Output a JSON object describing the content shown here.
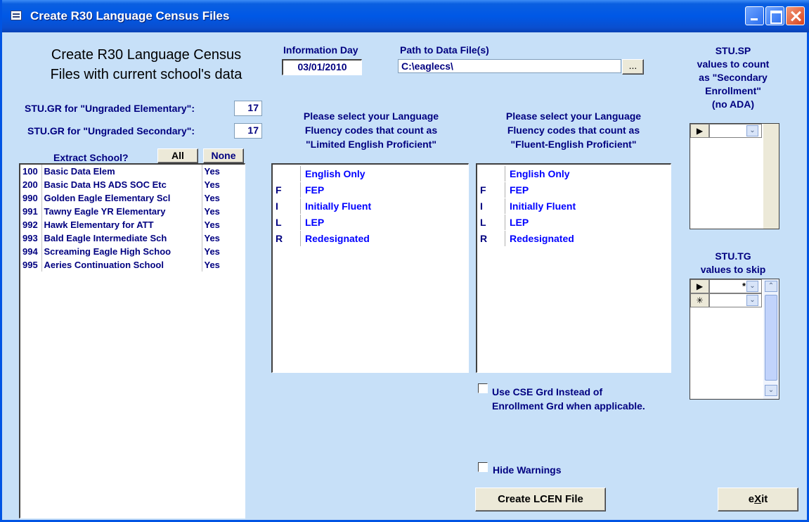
{
  "window": {
    "title": "Create R30 Language Census Files"
  },
  "heading": {
    "line1": "Create R30 Language Census",
    "line2": "Files with current school's data"
  },
  "ungraded": {
    "elem_label": "STU.GR for \"Ungraded Elementary\":",
    "elem_value": "17",
    "sec_label": "STU.GR for \"Ungraded Secondary\":",
    "sec_value": "17"
  },
  "extract": {
    "label": "Extract School?",
    "all_label": "All",
    "none_label": "None"
  },
  "schools": [
    {
      "code": "100",
      "name": "Basic Data Elem",
      "extract": "Yes"
    },
    {
      "code": "200",
      "name": "Basic Data HS ADS SOC Etc",
      "extract": "Yes"
    },
    {
      "code": "990",
      "name": "Golden Eagle Elementary Scl",
      "extract": "Yes"
    },
    {
      "code": "991",
      "name": "Tawny Eagle YR Elementary",
      "extract": "Yes"
    },
    {
      "code": "992",
      "name": "Hawk Elementary for ATT",
      "extract": "Yes"
    },
    {
      "code": "993",
      "name": "Bald Eagle Intermediate Sch",
      "extract": "Yes"
    },
    {
      "code": "994",
      "name": "Screaming Eagle High Schoo",
      "extract": "Yes"
    },
    {
      "code": "995",
      "name": "Aeries Continuation School",
      "extract": "Yes"
    }
  ],
  "info_day": {
    "label": "Information Day",
    "value": "03/01/2010"
  },
  "path": {
    "label": "Path to Data File(s)",
    "value": "C:\\eaglecs\\",
    "browse_label": "..."
  },
  "lep": {
    "line1": "Please select your Language",
    "line2": "Fluency codes that count as",
    "line3": "\"Limited English Proficient\""
  },
  "fep": {
    "line1": "Please select your Language",
    "line2": "Fluency codes that count as",
    "line3": "\"Fluent-English Proficient\""
  },
  "fluency_codes": [
    {
      "code": "",
      "name": "English Only"
    },
    {
      "code": "F",
      "name": "FEP"
    },
    {
      "code": "I",
      "name": "Initially Fluent"
    },
    {
      "code": "L",
      "name": "LEP"
    },
    {
      "code": "R",
      "name": "Redesignated"
    }
  ],
  "stu_sp": {
    "line1": "STU.SP",
    "line2": "values to count",
    "line3": "as \"Secondary",
    "line4": "Enrollment\"",
    "line5": "(no ADA)"
  },
  "stu_tg": {
    "line1": "STU.TG",
    "line2": "values to skip",
    "row1_value": "*"
  },
  "options": {
    "cse_line1": "Use CSE Grd Instead of",
    "cse_line2": "Enrollment Grd when applicable.",
    "hide_warnings": "Hide Warnings"
  },
  "buttons": {
    "create": "Create LCEN File",
    "exit_pre": "e",
    "exit_mnemonic": "X",
    "exit_post": "it"
  },
  "colors": {
    "form_bg": "#c7e0f8",
    "label": "#000080",
    "titlebar": "#0058e6"
  }
}
